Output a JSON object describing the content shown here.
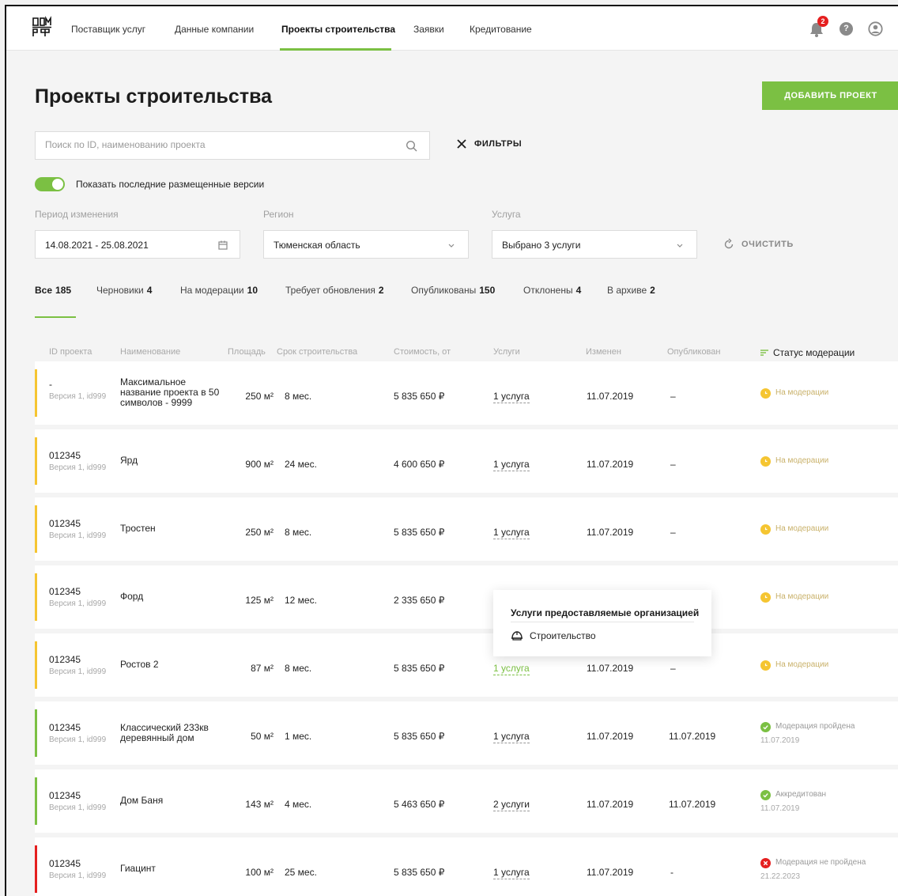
{
  "nav": {
    "items": [
      "Поставщик услуг",
      "Данные компании",
      "Проекты строительства",
      "Заявки",
      "Кредитование"
    ],
    "notifications_count": "2",
    "help_label": "?"
  },
  "page": {
    "title": "Проекты строительства",
    "add_button": "ДОБАВИТЬ ПРОЕКТ"
  },
  "search": {
    "placeholder": "Поиск по ID, наименованию проекта",
    "filters_label": "ФИЛЬТРЫ"
  },
  "toggle": {
    "label": "Показать последние размещенные версии",
    "on": true
  },
  "filters": {
    "period_label": "Период изменения",
    "period_value": "14.08.2021 - 25.08.2021",
    "region_label": "Регион",
    "region_value": "Тюменская область",
    "service_label": "Услуга",
    "service_value": "Выбрано 3 услуги",
    "clear_label": "ОЧИСТИТЬ"
  },
  "tabs": [
    {
      "label": "Все",
      "count": "185"
    },
    {
      "label": "Черновики",
      "count": "4"
    },
    {
      "label": "На модерации",
      "count": "10"
    },
    {
      "label": "Требует обновления",
      "count": "2"
    },
    {
      "label": "Опубликованы",
      "count": "150"
    },
    {
      "label": "Отклонены",
      "count": "4"
    },
    {
      "label": "В архиве",
      "count": "2"
    }
  ],
  "columns": [
    "ID проекта",
    "Наименование",
    "Площадь",
    "Срок строительства",
    "Стоимость, от",
    "Услуги",
    "Изменен",
    "Опубликован",
    "Статус модерации"
  ],
  "colors": {
    "accent": "#7bc043",
    "moderation": "#f5c531",
    "passed": "#7bc043",
    "failed": "#e51f1f"
  },
  "rows": [
    {
      "id": "-",
      "version": "Версия 1, id999",
      "name": "Максимальное название проекта в 50 символов - 9999",
      "area": "250 м²",
      "term": "8 мес.",
      "cost": "5 835 650 ₽",
      "services": "1 услуга",
      "changed": "11.07.2019",
      "published": "–",
      "status": "На модерации",
      "status_date": ""
    },
    {
      "id": "012345",
      "version": "Версия 1, id999",
      "name": "Ярд",
      "area": "900 м²",
      "term": "24 мес.",
      "cost": "4 600 650 ₽",
      "services": "1 услуга",
      "changed": "11.07.2019",
      "published": "–",
      "status": "На модерации",
      "status_date": ""
    },
    {
      "id": "012345",
      "version": "Версия 1, id999",
      "name": "Тростен",
      "area": "250 м²",
      "term": "8 мес.",
      "cost": "5 835 650 ₽",
      "services": "1 услуга",
      "changed": "11.07.2019",
      "published": "–",
      "status": "На модерации",
      "status_date": ""
    },
    {
      "id": "012345",
      "version": "Версия 1, id999",
      "name": "Форд",
      "area": "125 м²",
      "term": "12 мес.",
      "cost": "2 335 650 ₽",
      "services": "",
      "changed": "",
      "published": "",
      "status": "На модерации",
      "status_date": ""
    },
    {
      "id": "012345",
      "version": "Версия 1, id999",
      "name": "Ростов 2",
      "area": "87 м²",
      "term": "8 мес.",
      "cost": "5 835 650 ₽",
      "services": "1 услуга",
      "changed": "11.07.2019",
      "published": "–",
      "status": "На модерации",
      "status_date": ""
    },
    {
      "id": "012345",
      "version": "Версия 1, id999",
      "name": "Классический 233кв деревянный дом",
      "area": "50 м²",
      "term": "1 мес.",
      "cost": "5 835 650 ₽",
      "services": "1 услуга",
      "changed": "11.07.2019",
      "published": "11.07.2019",
      "status": "Модерация пройдена",
      "status_date": "11.07.2019"
    },
    {
      "id": "012345",
      "version": "Версия 1, id999",
      "name": "Дом Баня",
      "area": "143 м²",
      "term": "4 мес.",
      "cost": "5 463 650 ₽",
      "services": "2 услуги",
      "changed": "11.07.2019",
      "published": "11.07.2019",
      "status": "Аккредитован",
      "status_date": "11.07.2019"
    },
    {
      "id": "012345",
      "version": "Версия 1, id999",
      "name": "Гиацинт",
      "area": "100 м²",
      "term": "25 мес.",
      "cost": "5 835 650 ₽",
      "services": "1 услуга",
      "changed": "11.07.2019",
      "published": "-",
      "status": "Модерация не пройдена",
      "status_date": "21.22.2023"
    }
  ],
  "popup": {
    "title": "Услуги предоставляемые организацией",
    "item": "Строительство",
    "item_icon": "hard-hat-icon"
  }
}
